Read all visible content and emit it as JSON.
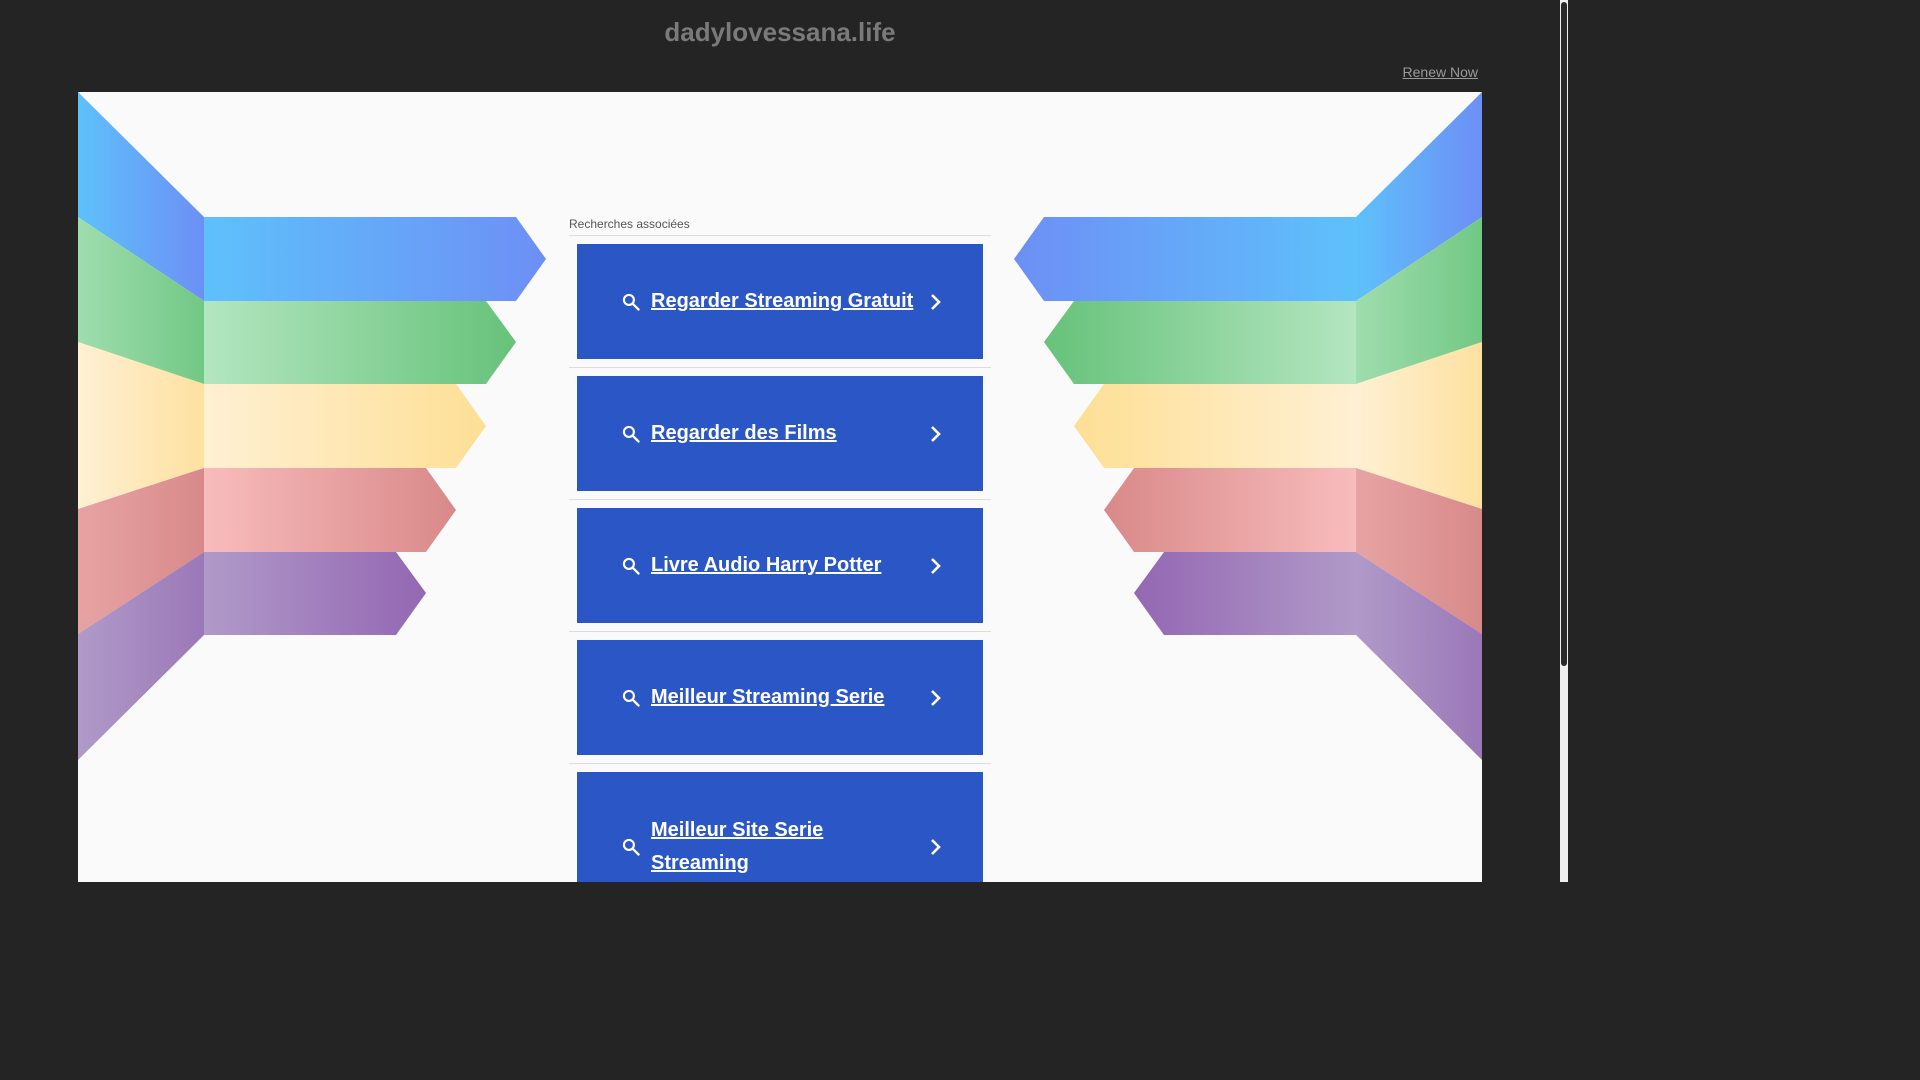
{
  "header": {
    "domain_title": "dadylovessana.life",
    "renew_label": "Renew Now"
  },
  "related": {
    "title": "Recherches associées",
    "items": [
      {
        "label": "Regarder Streaming Gratuit"
      },
      {
        "label": "Regarder des Films"
      },
      {
        "label": "Livre Audio Harry Potter"
      },
      {
        "label": "Meilleur Streaming Serie"
      },
      {
        "label": "Meilleur Site Serie Streaming"
      }
    ]
  },
  "icons": {
    "result": "search-icon",
    "arrow": "chevron-right-icon"
  },
  "colors": {
    "page_background": "#242424",
    "content_background": "#fafafa",
    "button_background": "#2b56c6",
    "button_text": "#ffffff",
    "title_text": "#7a7a7a",
    "band_blue": "#62a9f5",
    "band_green": "#7fcf8a",
    "band_yellow": "#fde3a7",
    "band_red": "#e59b9b",
    "band_purple": "#a688c0"
  }
}
